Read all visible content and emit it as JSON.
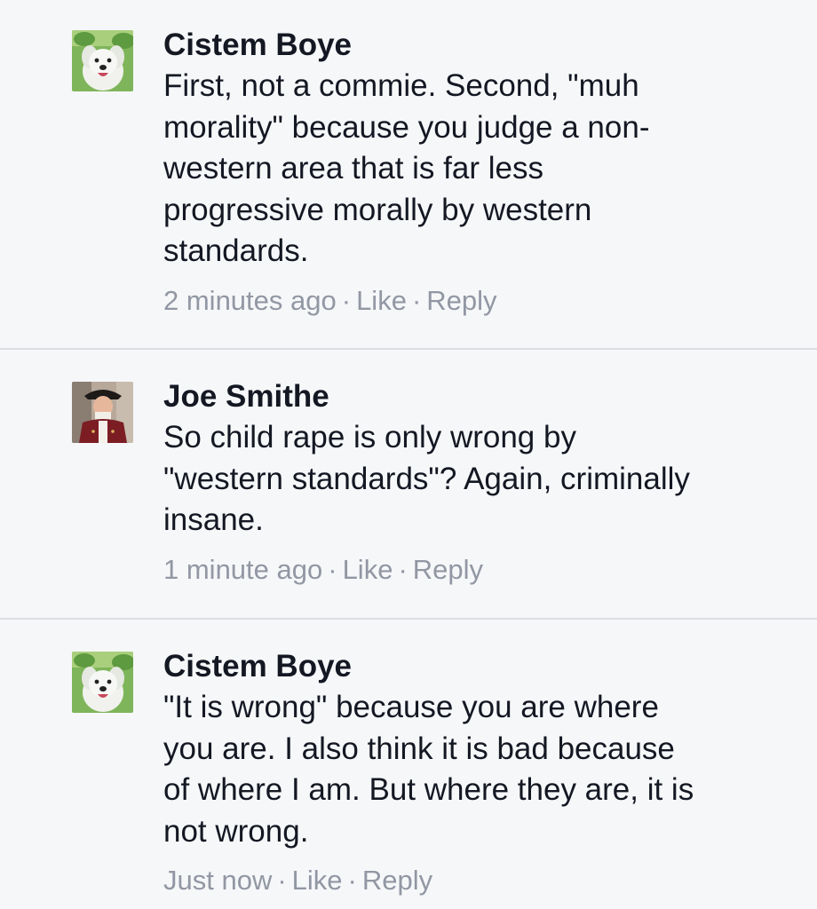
{
  "comments": [
    {
      "author": "Cistem Boye",
      "lines": [
        "First, not a commie. Second, \"muh",
        "morality\" because you judge a non-",
        "western area that is far less",
        "progressive morally by western",
        "standards."
      ],
      "time": "2 minutes ago",
      "like_label": "Like",
      "reply_label": "Reply",
      "avatar_icon": "dog-avatar-icon"
    },
    {
      "author": "Joe Smithe",
      "lines": [
        "So child rape is only wrong by",
        "\"western standards\"? Again, criminally",
        "insane."
      ],
      "time": "1 minute ago",
      "like_label": "Like",
      "reply_label": "Reply",
      "avatar_icon": "colonial-man-avatar-icon"
    },
    {
      "author": "Cistem Boye",
      "lines": [
        "\"It is wrong\" because you are where",
        "you are. I also think it is bad because",
        "of where I am. But where they are, it is",
        "not wrong."
      ],
      "time": "Just now",
      "like_label": "Like",
      "reply_label": "Reply",
      "avatar_icon": "dog-avatar-icon"
    }
  ],
  "separator": "·",
  "colors": {
    "background": "#f6f7f9",
    "text": "#141823",
    "meta": "#9197a3",
    "divider": "#dcdee3"
  }
}
